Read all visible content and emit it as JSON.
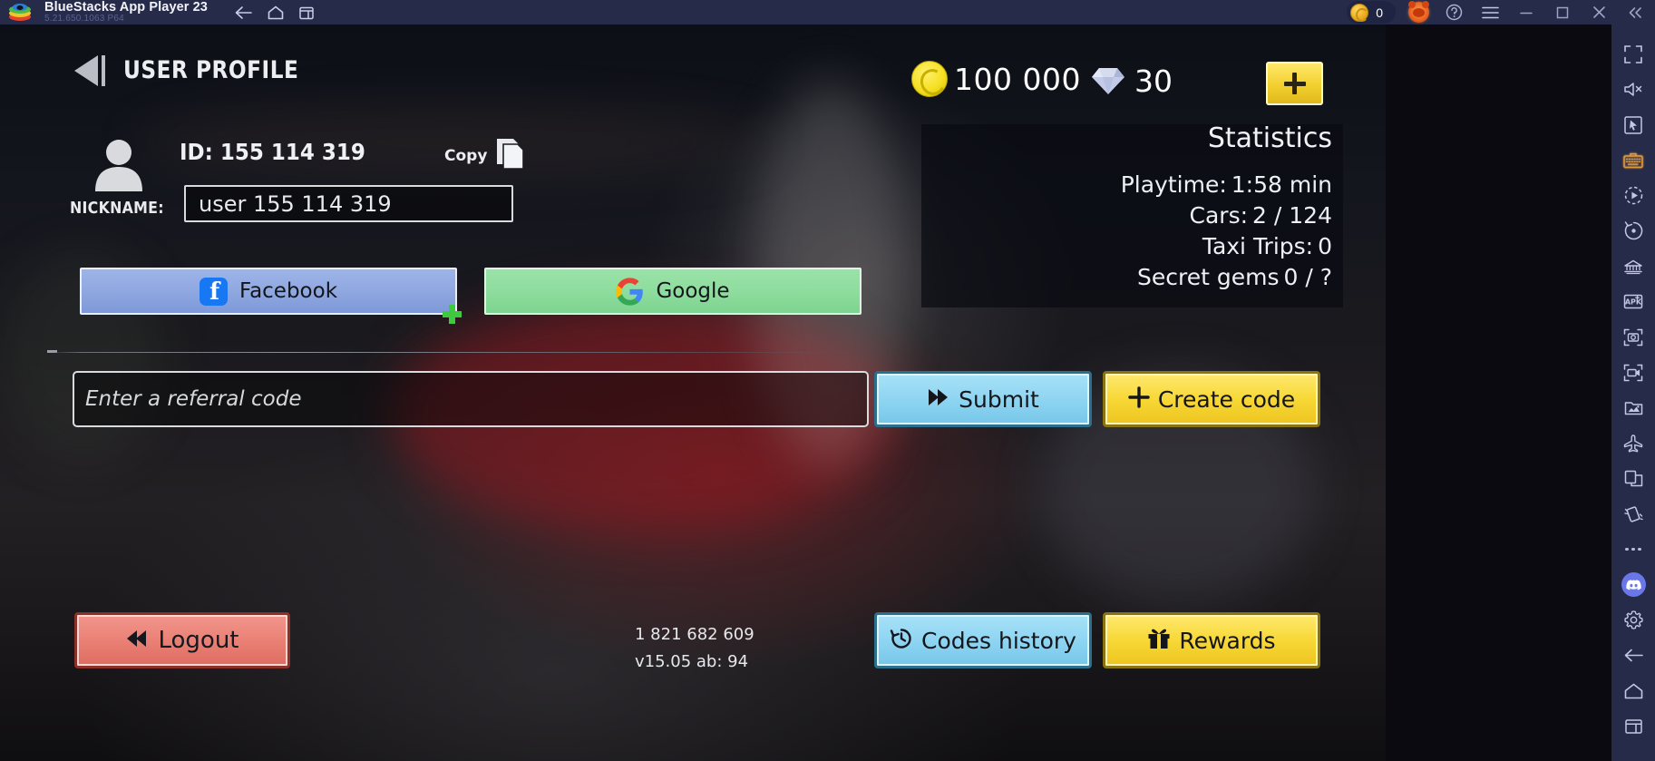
{
  "titlebar": {
    "app_name": "BlueStacks App Player 23",
    "version": "5.21.650.1063  P64",
    "logo_icon": "bluestacks-logo",
    "nav": [
      {
        "icon": "back-arrow-icon",
        "name": "back"
      },
      {
        "icon": "home-icon",
        "name": "home"
      },
      {
        "icon": "multi-instance-icon",
        "name": "multi-instance"
      }
    ],
    "points_value": "0",
    "points_icon": "coin-icon",
    "profile_icon": "bear-avatar-icon",
    "help_icon": "help-circle-icon",
    "menu_icon": "hamburger-menu-icon",
    "minimize_icon": "minimize-icon",
    "maximize_icon": "maximize-icon",
    "close_icon": "close-icon",
    "collapse_icon": "double-chevron-left-icon"
  },
  "game": {
    "header": {
      "back_icon": "back-triangle-icon",
      "title": "USER PROFILE",
      "coins": "100 000",
      "coin_icon": "gold-coin-icon",
      "gems": "30",
      "gem_icon": "diamond-icon",
      "add_icon": "plus-icon"
    },
    "profile": {
      "avatar_icon": "user-avatar-icon",
      "id_label": "ID: 155 114 319",
      "copy_label": "Copy",
      "copy_icon": "copy-pages-icon",
      "nickname_label": "NICKNAME:",
      "nickname_value": "user 155 114 319"
    },
    "social": {
      "facebook_label": "Facebook",
      "facebook_icon": "facebook-icon",
      "google_label": "Google",
      "google_icon": "google-icon",
      "add_account_icon": "green-plus-icon"
    },
    "referral": {
      "placeholder": "Enter a referral code",
      "submit_label": "Submit",
      "submit_icon": "double-chevron-right-icon",
      "create_label": "Create code",
      "create_icon": "plus-icon"
    },
    "statistics": {
      "title": "Statistics",
      "rows": [
        {
          "label": "Playtime:",
          "value": "1:58 min"
        },
        {
          "label": "Cars:",
          "value": "2 / 124"
        },
        {
          "label": "Taxi Trips:",
          "value": "0"
        },
        {
          "label": "Secret gems",
          "value": "0 / ?"
        }
      ]
    },
    "footer": {
      "logout_label": "Logout",
      "logout_icon": "double-chevron-left-icon",
      "build_number": "1 821 682 609",
      "version_line": "v15.05 ab: 94",
      "codes_history_label": "Codes history",
      "codes_history_icon": "clock-history-icon",
      "rewards_label": "Rewards",
      "rewards_icon": "gift-icon"
    }
  },
  "sidebar": {
    "items": [
      {
        "icon": "fullscreen-icon",
        "name": "fullscreen"
      },
      {
        "icon": "mute-icon",
        "name": "mute-volume"
      },
      {
        "icon": "pointer-icon",
        "name": "game-controls"
      },
      {
        "icon": "keyboard-icon",
        "name": "keyboard-controls",
        "active": true
      },
      {
        "icon": "macro-play-icon",
        "name": "macro-recorder"
      },
      {
        "icon": "rotate-icon",
        "name": "rotate-screen"
      },
      {
        "icon": "atm-icon",
        "name": "real-time-translation"
      },
      {
        "icon": "apk-install-icon",
        "name": "install-apk"
      },
      {
        "icon": "screenshot-icon",
        "name": "screenshot"
      },
      {
        "icon": "video-record-icon",
        "name": "record-screen"
      },
      {
        "icon": "media-manager-icon",
        "name": "media-manager"
      },
      {
        "icon": "airplane-icon",
        "name": "eco-mode"
      },
      {
        "icon": "copy-window-icon",
        "name": "copy-instance"
      },
      {
        "icon": "shake-icon",
        "name": "shake-device"
      },
      {
        "icon": "more-dots-icon",
        "name": "more-options"
      },
      {
        "icon": "discord-icon",
        "name": "discord"
      },
      {
        "icon": "gear-icon",
        "name": "settings"
      },
      {
        "icon": "back-arrow-icon",
        "name": "android-back"
      },
      {
        "icon": "home-icon",
        "name": "android-home"
      },
      {
        "icon": "recents-icon",
        "name": "android-recents"
      }
    ],
    "accent_color": "#e09a3a",
    "discord_color": "#6a77e8"
  }
}
